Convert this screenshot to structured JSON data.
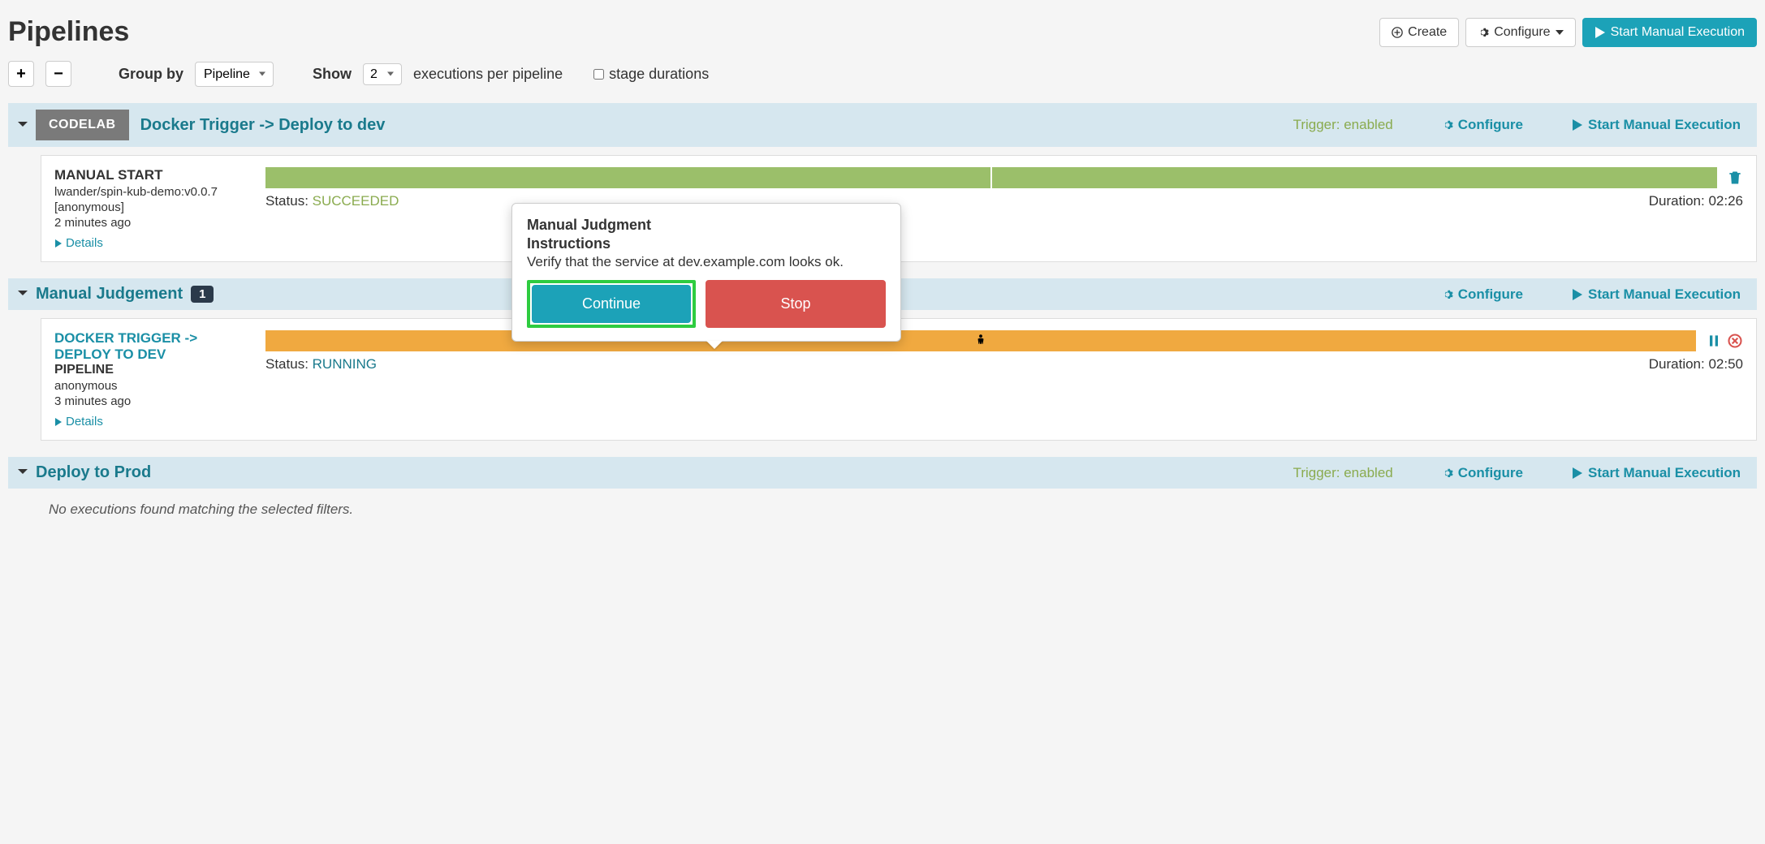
{
  "page": {
    "title": "Pipelines"
  },
  "header_actions": {
    "create": "Create",
    "configure": "Configure",
    "start_manual": "Start Manual Execution"
  },
  "filter": {
    "group_by_label": "Group by",
    "group_by_value": "Pipeline",
    "show_label": "Show",
    "show_value": "2",
    "per_pipeline_label": "executions per pipeline",
    "stage_durations_label": "stage durations"
  },
  "pipelines": [
    {
      "badge": "CODELAB",
      "name": "Docker Trigger -> Deploy to dev",
      "trigger": "Trigger: enabled",
      "configure": "Configure",
      "start": "Start Manual Execution",
      "execution": {
        "title": "MANUAL START",
        "sub1": "lwander/spin-kub-demo:v0.0.7",
        "sub2": "[anonymous]",
        "time": "2 minutes ago",
        "details": "Details",
        "status_label": "Status: ",
        "status_value": "SUCCEEDED",
        "duration": "Duration: 02:26"
      }
    },
    {
      "name": "Manual Judgement",
      "count": "1",
      "configure": "Configure",
      "start": "Start Manual Execution",
      "execution": {
        "title": "DOCKER TRIGGER -> DEPLOY TO DEV",
        "sub1": "PIPELINE",
        "sub2": "anonymous",
        "time": "3 minutes ago",
        "details": "Details",
        "status_label": "Status: ",
        "status_value": "RUNNING",
        "duration": "Duration: 02:50"
      }
    },
    {
      "name": "Deploy to Prod",
      "trigger": "Trigger: enabled",
      "configure": "Configure",
      "start": "Start Manual Execution",
      "no_exec": "No executions found matching the selected filters."
    }
  ],
  "popover": {
    "title": "Manual Judgment",
    "instructions_label": "Instructions",
    "instructions": "Verify that the service at dev.example.com looks ok.",
    "continue": "Continue",
    "stop": "Stop"
  }
}
